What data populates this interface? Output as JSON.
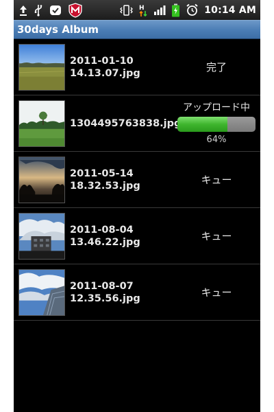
{
  "statusbar": {
    "time": "10:14 AM",
    "left_icons": [
      "upload-arrow-icon",
      "usb-icon",
      "notification-icon",
      "mcafee-icon"
    ],
    "right_icons": [
      "vibrate-icon",
      "hspa-data-icon",
      "signal-bars-icon",
      "battery-charging-icon",
      "alarm-clock-icon"
    ]
  },
  "app": {
    "title": "30days Album"
  },
  "rows": [
    {
      "filename": "2011-01-10\n14.13.07.jpg",
      "status": "完了"
    },
    {
      "filename": "1304495763838.jpg",
      "status": "アップロード中",
      "progress_percent": 64,
      "progress_label": "64%"
    },
    {
      "filename": "2011-05-14\n18.32.53.jpg",
      "status": "キュー"
    },
    {
      "filename": "2011-08-04\n13.46.22.jpg",
      "status": "キュー"
    },
    {
      "filename": "2011-08-07\n12.35.56.jpg",
      "status": "キュー"
    }
  ],
  "colors": {
    "titlebar": "#4a7cb4",
    "progress_fill": "#3fb52e",
    "progress_track": "#8a8a8a",
    "background": "#000000"
  }
}
